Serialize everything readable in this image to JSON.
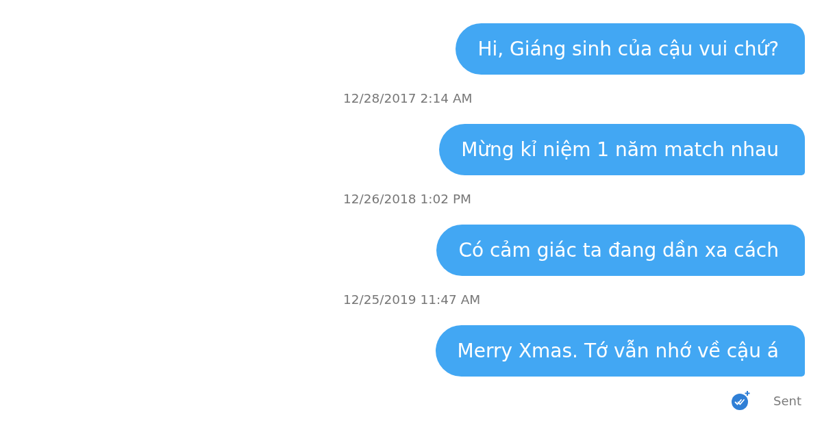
{
  "conversation": [
    {
      "kind": "message",
      "text": "Hi, Giáng sinh của cậu vui chứ?"
    },
    {
      "kind": "timestamp",
      "text": "12/28/2017 2:14 AM"
    },
    {
      "kind": "message",
      "text": "Mừng kỉ niệm 1 năm match nhau"
    },
    {
      "kind": "timestamp",
      "text": "12/26/2018 1:02 PM"
    },
    {
      "kind": "message",
      "text": "Có cảm giác ta đang dần xa cách"
    },
    {
      "kind": "timestamp",
      "text": "12/25/2019 11:47 AM"
    },
    {
      "kind": "message",
      "text": "Merry Xmas. Tớ vẫn nhớ về cậu á"
    }
  ],
  "delivery_status": {
    "label": "Sent"
  }
}
